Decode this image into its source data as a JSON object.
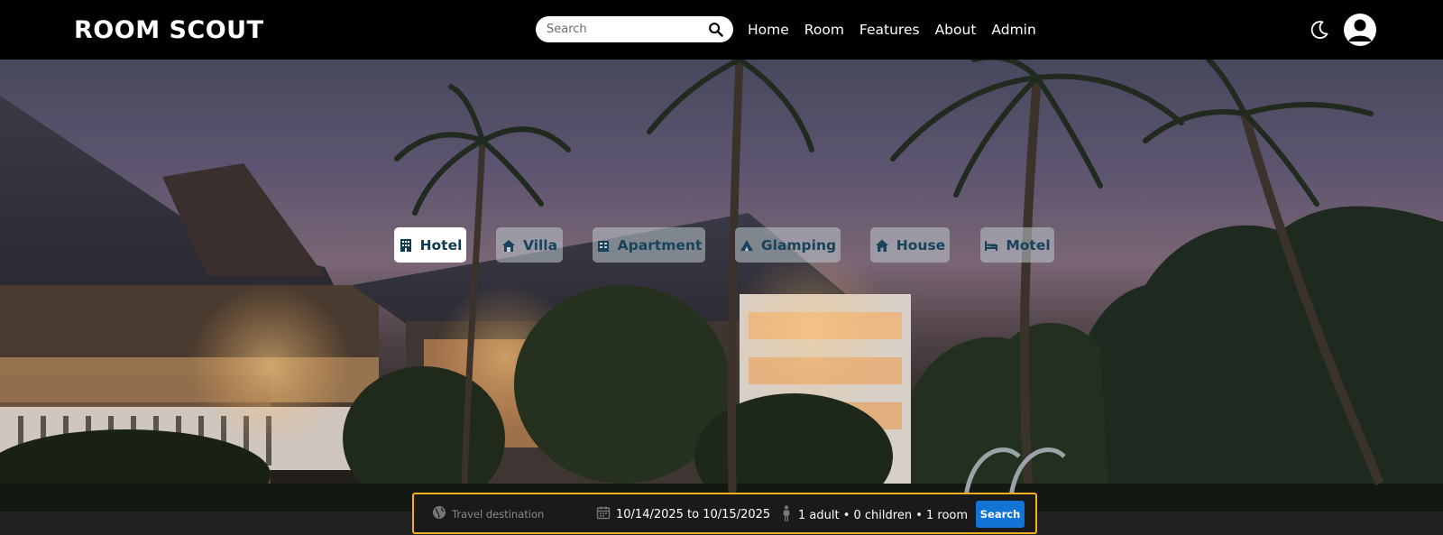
{
  "brand": {
    "name": "ROOM SCOUT"
  },
  "nav": {
    "search_placeholder": "Search",
    "links": [
      "Home",
      "Room",
      "Features",
      "About",
      "Admin"
    ],
    "theme_icon": "moon-icon",
    "account_icon": "user-circle-icon"
  },
  "categories": [
    {
      "label": "Hotel",
      "icon": "building-icon",
      "active": true
    },
    {
      "label": "Villa",
      "icon": "villa-icon",
      "active": false
    },
    {
      "label": "Apartment",
      "icon": "apartment-icon",
      "active": false
    },
    {
      "label": "Glamping",
      "icon": "tent-icon",
      "active": false
    },
    {
      "label": "House",
      "icon": "house-icon",
      "active": false
    },
    {
      "label": "Motel",
      "icon": "bed-icon",
      "active": false
    }
  ],
  "booking": {
    "destination_placeholder": "Travel destination",
    "dates": "10/14/2025 to 10/15/2025",
    "guests": "1 adult • 0 children • 1 room",
    "search_label": "Search"
  },
  "colors": {
    "nav_bg": "#000000",
    "chip_text": "#18435a",
    "bookbar_border": "#f2b01e",
    "search_button": "#1274d4"
  }
}
